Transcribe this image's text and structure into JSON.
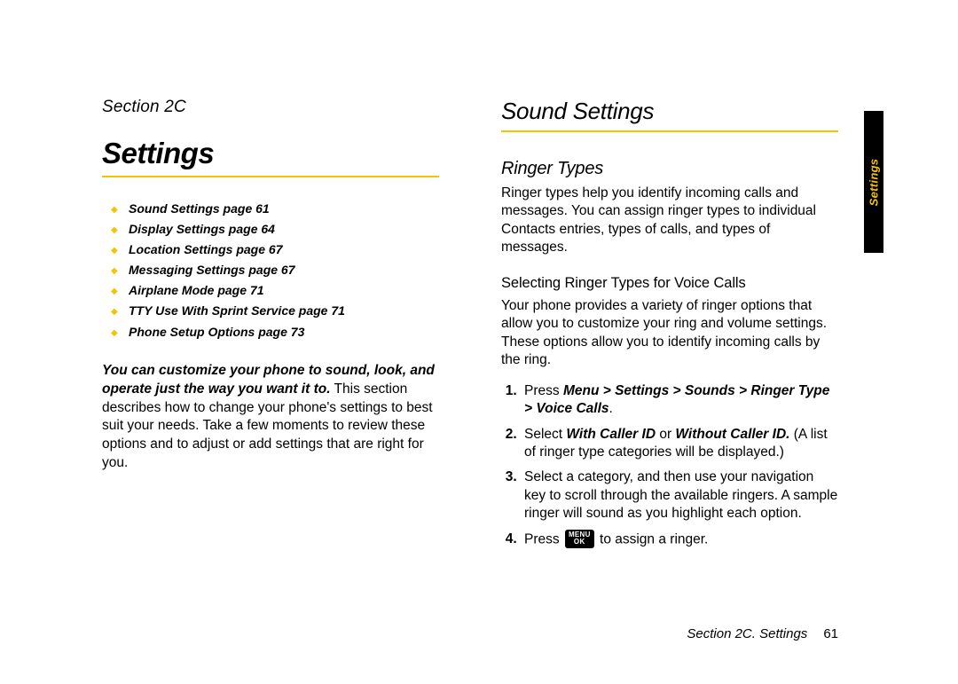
{
  "left": {
    "section_label": "Section 2C",
    "title": "Settings",
    "toc": [
      "Sound Settings page 61",
      "Display Settings page 64",
      "Location Settings page 67",
      "Messaging Settings page 67",
      "Airplane Mode page 71",
      "TTY Use With Sprint Service page 71",
      "Phone Setup Options page 73"
    ],
    "intro_lead": "You can customize your phone to sound, look, and operate just the way you want it to.",
    "intro_rest": " This section describes how to change your phone's settings to best suit your needs. Take a few moments to review these options and to adjust or add settings that are right for you."
  },
  "right": {
    "title": "Sound Settings",
    "subheading": "Ringer Types",
    "para1": "Ringer types help you identify incoming calls and messages. You can assign ringer types to individual Contacts entries, types of calls, and types of messages.",
    "h3": "Selecting Ringer Types for Voice Calls",
    "para2": "Your phone provides a variety of ringer options that allow you to customize your ring and volume settings. These options allow you to identify incoming calls by the ring.",
    "step1_a": "Press ",
    "step1_b": "Menu > Settings > Sounds > Ringer Type > Voice Calls",
    "step1_c": ".",
    "step2_a": "Select ",
    "step2_b": "With Caller ID",
    "step2_c": " or ",
    "step2_d": "Without Caller ID.",
    "step2_e": " (A list of ringer type categories will be displayed.)",
    "step3": "Select a category, and then use your navigation key to scroll through the available ringers. A sample ringer will sound as you highlight each option.",
    "step4_a": "Press ",
    "step4_b": " to assign a ringer.",
    "menu_key_l1": "MENU",
    "menu_key_l2": "OK"
  },
  "footer": {
    "section": "Section 2C. Settings",
    "page": "61"
  },
  "sidetab": "Settings"
}
